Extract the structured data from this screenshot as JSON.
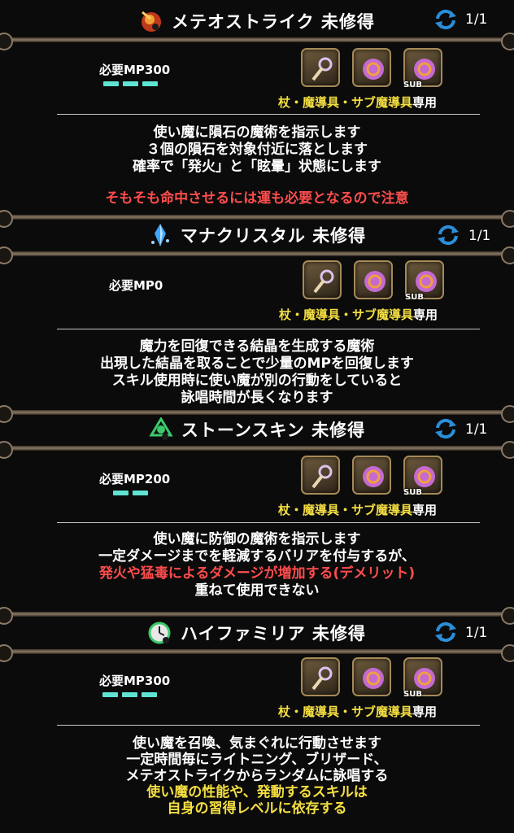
{
  "colors": {
    "mp_bar": "#5fe3d3",
    "usable_text": "#f5df42",
    "warning": "#ff4d4d",
    "highlight": "#f5df42",
    "background": "#0b0b0b"
  },
  "skills": [
    {
      "icon": "meteor-skill-icon",
      "title": "メテオストライク 未修得",
      "level": "1/1",
      "mp": "必要MP300",
      "mp_bars": 3,
      "weapons": [
        "staff-icon",
        "magic-tool-icon",
        "sub-magic-tool-icon"
      ],
      "sub_label": "SUB",
      "usable_main": "杖・魔導具・サブ魔導具",
      "usable_suffix": "専用",
      "desc": [
        "使い魔に隕石の魔術を指示します",
        "３個の隕石を対象付近に落とします",
        "確率で「発火」と「眩暈」状態にします"
      ],
      "note": "そもそも命中させるには運も必要となるので注意"
    },
    {
      "icon": "crystal-skill-icon",
      "title": "マナクリスタル 未修得",
      "level": "1/1",
      "mp": "必要MP0",
      "mp_bars": 0,
      "weapons": [
        "staff-icon",
        "magic-tool-icon",
        "sub-magic-tool-icon"
      ],
      "sub_label": "SUB",
      "usable_main": "杖・魔導具・サブ魔導具",
      "usable_suffix": "専用",
      "desc": [
        "魔力を回復できる結晶を生成する魔術",
        "出現した結晶を取ることで少量のMPを回復します",
        "スキル使用時に使い魔が別の行動をしていると",
        "詠唱時間が長くなります"
      ]
    },
    {
      "icon": "stoneskin-skill-icon",
      "title": "ストーンスキン 未修得",
      "level": "1/1",
      "mp": "必要MP200",
      "mp_bars": 2,
      "weapons": [
        "staff-icon",
        "magic-tool-icon",
        "sub-magic-tool-icon"
      ],
      "sub_label": "SUB",
      "usable_main": "杖・魔導具・サブ魔導具",
      "usable_suffix": "専用",
      "desc": [
        "使い魔に防御の魔術を指示します",
        "一定ダメージまでを軽減するバリアを付与するが、"
      ],
      "desc_red": "発火や猛毒によるダメージが増加する(デメリット)",
      "desc_after": "重ねて使用できない"
    },
    {
      "icon": "highfamiliar-skill-icon",
      "title": "ハイファミリア 未修得",
      "level": "1/1",
      "mp": "必要MP300",
      "mp_bars": 3,
      "weapons": [
        "staff-icon",
        "magic-tool-icon",
        "sub-magic-tool-icon"
      ],
      "sub_label": "SUB",
      "usable_main": "杖・魔導具・サブ魔導具",
      "usable_suffix": "専用",
      "desc": [
        "使い魔を召喚、気まぐれに行動させます",
        "一定時間毎にライトニング、ブリザード、",
        "メテオストライクからランダムに詠唱する"
      ],
      "desc_yellow": [
        "使い魔の性能や、発動するスキルは",
        "自身の習得レベルに依存する"
      ]
    }
  ]
}
